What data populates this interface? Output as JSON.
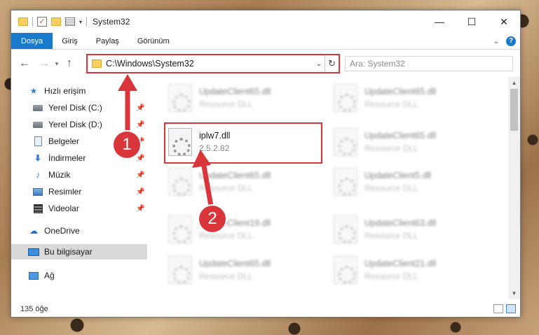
{
  "window": {
    "title": "System32"
  },
  "ribbon": {
    "tabs": [
      "Dosya",
      "Giriş",
      "Paylaş",
      "Görünüm"
    ]
  },
  "navbar": {
    "address_path": "C:\\Windows\\System32",
    "search_placeholder": "Ara: System32"
  },
  "sidebar": {
    "items": [
      {
        "label": "Hızlı erişim",
        "icon": "star-icon"
      },
      {
        "label": "Yerel Disk (C:)",
        "icon": "disk-icon"
      },
      {
        "label": "Yerel Disk (D:)",
        "icon": "disk-icon"
      },
      {
        "label": "Belgeler",
        "icon": "documents-icon"
      },
      {
        "label": "İndirmeler",
        "icon": "download-icon"
      },
      {
        "label": "Müzik",
        "icon": "music-icon"
      },
      {
        "label": "Resimler",
        "icon": "pictures-icon"
      },
      {
        "label": "Videolar",
        "icon": "videos-icon"
      },
      {
        "label": "OneDrive",
        "icon": "cloud-icon"
      },
      {
        "label": "Bu bilgisayar",
        "icon": "computer-icon",
        "selected": true
      },
      {
        "label": "Ağ",
        "icon": "network-icon"
      }
    ]
  },
  "files": [
    {
      "name": "UpdateClient65.dll",
      "type": "Resource DLL"
    },
    {
      "name": "UpdateClient65.dll",
      "type": "Resource DLL"
    },
    {
      "name": "iplw7.dll",
      "type": "2.5.2.82"
    },
    {
      "name": "UpdateClient65.dll",
      "type": "Resource DLL"
    },
    {
      "name": "UpdateClient65.dll",
      "type": "Resource DLL"
    },
    {
      "name": "UpdateClient5.dll",
      "type": "Resource DLL"
    },
    {
      "name": "UpdateClient19.dll",
      "type": "Resource DLL"
    },
    {
      "name": "UpdateClient63.dll",
      "type": "Resource DLL"
    },
    {
      "name": "UpdateClient65.dll",
      "type": "Resource DLL"
    },
    {
      "name": "UpdateClient21.dll",
      "type": "Resource DLL"
    }
  ],
  "status": {
    "item_count": "135 öğe"
  },
  "annotations": {
    "badge1": "1",
    "badge2": "2"
  },
  "colors": {
    "accent": "#1979ca",
    "annotation_red": "#d8363b"
  }
}
